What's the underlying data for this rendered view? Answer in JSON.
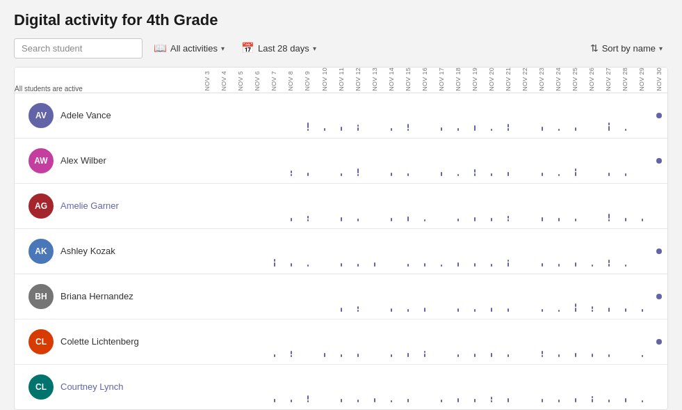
{
  "page": {
    "title": "Digital activity for 4th Grade"
  },
  "toolbar": {
    "search_placeholder": "Search student",
    "activities_label": "All activities",
    "date_range_label": "Last 28 days",
    "sort_label": "Sort by name"
  },
  "table": {
    "header_label": "All students are active",
    "dates": [
      "NOV 3",
      "NOV 4",
      "NOV 5",
      "NOV 6",
      "NOV 7",
      "NOV 8",
      "NOV 9",
      "NOV 10",
      "NOV 11",
      "NOV 12",
      "NOV 13",
      "NOV 14",
      "NOV 15",
      "NOV 16",
      "NOV 17",
      "NOV 18",
      "NOV 19",
      "NOV 20",
      "NOV 21",
      "NOV 22",
      "NOV 23",
      "NOV 24",
      "NOV 25",
      "NOV 26",
      "NOV 27",
      "NOV 28",
      "NOV 29",
      "NOV 30"
    ],
    "students": [
      {
        "name": "Adele Vance",
        "initials": "AV",
        "avatar_color": "#6264a7",
        "name_color": "#333"
      },
      {
        "name": "Alex Wilber",
        "initials": "AW",
        "avatar_color": "#c43ea0",
        "name_color": "#333"
      },
      {
        "name": "Amelie Garner",
        "initials": "AG",
        "avatar_color": "#a4262c",
        "name_color": "#6264a7"
      },
      {
        "name": "Ashley Kozak",
        "initials": "AK",
        "avatar_color": "#4a77b8",
        "name_color": "#333"
      },
      {
        "name": "Briana Hernandez",
        "initials": "BH",
        "avatar_color": "#757575",
        "name_color": "#333"
      },
      {
        "name": "Colette Lichtenberg",
        "initials": "CL",
        "avatar_color": "#d83b01",
        "name_color": "#333"
      },
      {
        "name": "Courtney Lynch",
        "initials": "CL",
        "avatar_color": "#00736c",
        "name_color": "#6264a7"
      }
    ]
  }
}
